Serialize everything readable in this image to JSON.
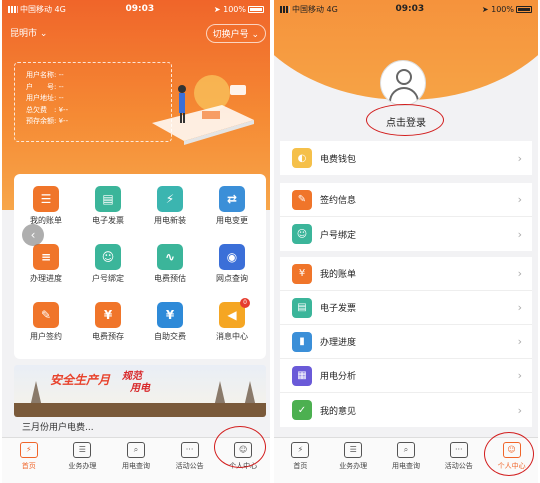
{
  "status": {
    "carrier": "中国移动",
    "network": "4G",
    "time": "09:03",
    "battery": "100%"
  },
  "left": {
    "city": "昆明市",
    "switch_account": "切换户号",
    "info": {
      "name": "用户名称: --",
      "account": "户　　号: --",
      "address": "用户地址: --",
      "arrears": "总欠费　: ¥--",
      "prepaid": "预存余额: ¥--"
    },
    "grid": [
      {
        "label": "我的账单",
        "icon": "bill-icon",
        "color": "#f0752a",
        "glyph": "☰"
      },
      {
        "label": "电子发票",
        "icon": "invoice-icon",
        "color": "#3bb59a",
        "glyph": "▤"
      },
      {
        "label": "用电新装",
        "icon": "new-install-icon",
        "color": "#3bb5b0",
        "glyph": "⚡"
      },
      {
        "label": "用电变更",
        "icon": "change-icon",
        "color": "#3b8fd8",
        "glyph": "⇄"
      },
      {
        "label": "办理进度",
        "icon": "progress-icon",
        "color": "#f0752a",
        "glyph": "≡"
      },
      {
        "label": "户号绑定",
        "icon": "bind-icon",
        "color": "#3bb59a",
        "glyph": "☺"
      },
      {
        "label": "电费预估",
        "icon": "estimate-icon",
        "color": "#3bb59a",
        "glyph": "∿"
      },
      {
        "label": "网点查询",
        "icon": "location-icon",
        "color": "#3b6fd8",
        "glyph": "◉"
      },
      {
        "label": "用户签约",
        "icon": "sign-icon",
        "color": "#f0752a",
        "glyph": "✎"
      },
      {
        "label": "电费预存",
        "icon": "prepay-icon",
        "color": "#f0752a",
        "glyph": "¥"
      },
      {
        "label": "自助交费",
        "icon": "selfpay-icon",
        "color": "#2e8ad8",
        "glyph": "¥"
      },
      {
        "label": "消息中心",
        "icon": "message-icon",
        "color": "#f5a623",
        "glyph": "◀"
      }
    ],
    "badge": "0",
    "banner": {
      "title": "安全生产月",
      "slogan1": "规范",
      "slogan2": "用电"
    },
    "peek": "三月份用户电费..."
  },
  "tabs": [
    {
      "label": "首页",
      "icon": "home-icon"
    },
    {
      "label": "业务办理",
      "icon": "business-icon"
    },
    {
      "label": "用电查询",
      "icon": "query-icon"
    },
    {
      "label": "活动公告",
      "icon": "notice-icon"
    },
    {
      "label": "个人中心",
      "icon": "profile-icon"
    }
  ],
  "right": {
    "login": "点击登录",
    "sections": [
      [
        {
          "label": "电费钱包",
          "icon": "wallet-icon",
          "color": "#f5c04a"
        }
      ],
      [
        {
          "label": "签约信息",
          "icon": "sign-info-icon",
          "color": "#f0752a"
        },
        {
          "label": "户号绑定",
          "icon": "bind-icon",
          "color": "#3bb59a"
        }
      ],
      [
        {
          "label": "我的账单",
          "icon": "bill-icon",
          "color": "#f0752a"
        },
        {
          "label": "电子发票",
          "icon": "invoice-icon",
          "color": "#3bb59a"
        },
        {
          "label": "办理进度",
          "icon": "progress-icon",
          "color": "#3b8fd8"
        },
        {
          "label": "用电分析",
          "icon": "analysis-icon",
          "color": "#6a5ad8"
        },
        {
          "label": "我的意见",
          "icon": "feedback-icon",
          "color": "#4cb050"
        }
      ]
    ]
  }
}
